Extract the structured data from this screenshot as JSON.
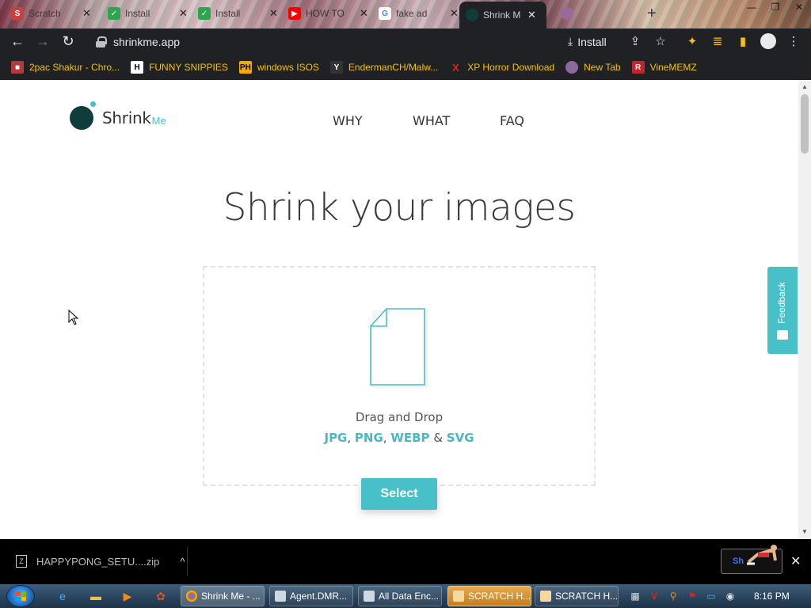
{
  "browser": {
    "tabs": [
      {
        "title": "Scratch",
        "favicon": "scratch-icon",
        "color": "#c94040"
      },
      {
        "title": "Install",
        "favicon": "shield-check-icon",
        "color": "#2da44e"
      },
      {
        "title": "Install",
        "favicon": "shield-check-icon",
        "color": "#2da44e"
      },
      {
        "title": "HOW TO",
        "favicon": "youtube-icon",
        "color": "#ff0000"
      },
      {
        "title": "fake ad",
        "favicon": "google-icon",
        "color": "#4285f4"
      },
      {
        "title": "Shrink M",
        "favicon": "shrinkme-icon",
        "color": "#113c3c"
      }
    ],
    "url": "shrinkme.app",
    "install_label": "Install"
  },
  "bookmarks": [
    {
      "label": "2pac Shakur - Chro...",
      "icon": "bag-icon",
      "icon_text": "■",
      "icon_bg": "#b33a3a"
    },
    {
      "label": "FUNNY SNIPPIES",
      "icon": "h-icon",
      "icon_text": "H",
      "icon_bg": "#ffffff"
    },
    {
      "label": "windows ISOS",
      "icon": "ph-icon",
      "icon_text": "PH",
      "icon_bg": "#f5a800"
    },
    {
      "label": "EndermanCH/Malw...",
      "icon": "y-icon",
      "icon_text": "Y",
      "icon_bg": "#333333"
    },
    {
      "label": "XP Horror Download",
      "icon": "x-icon",
      "icon_text": "X",
      "icon_bg": "#202124"
    },
    {
      "label": "New Tab",
      "icon": "globe-icon",
      "icon_text": "●",
      "icon_bg": "#8a6a9a"
    },
    {
      "label": "VineMEMZ",
      "icon": "r-icon",
      "icon_text": "R",
      "icon_bg": "#c0272d"
    }
  ],
  "site": {
    "logo_name": "Shrink",
    "logo_suffix": "Me",
    "nav": [
      "WHY",
      "WHAT",
      "FAQ"
    ],
    "headline": "Shrink your images",
    "drag_text": "Drag and Drop",
    "formats": [
      "JPG",
      "PNG",
      "WEBP",
      "SVG"
    ],
    "formats_join": ", ",
    "formats_and": " & ",
    "select_label": "Select",
    "feedback_label": "Feedback"
  },
  "download_bar": {
    "filename": "HAPPYPONG_SETU....zip",
    "ad_text": "Sh"
  },
  "taskbar": {
    "tasks": [
      {
        "label": "Shrink Me - ...",
        "icon": "chrome-icon"
      },
      {
        "label": "Agent.DMR...",
        "icon": "window-icon"
      },
      {
        "label": "All Data Enc...",
        "icon": "window-icon"
      },
      {
        "label": "SCRATCH H...",
        "icon": "scratch-icon"
      },
      {
        "label": "SCRATCH H...",
        "icon": "scratch-icon"
      }
    ],
    "clock": "8:16 PM"
  },
  "colors": {
    "accent": "#47c0c8",
    "logo_dark": "#113c3c",
    "bookmark_text": "#f5c200"
  }
}
